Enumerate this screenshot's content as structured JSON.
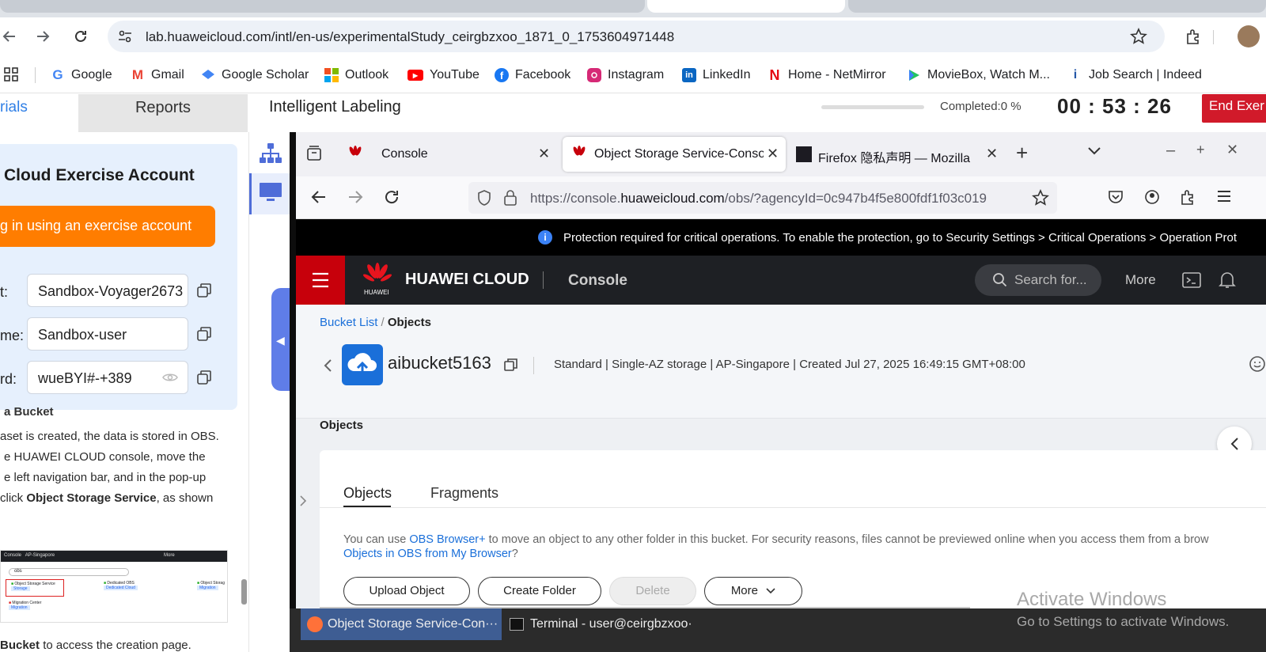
{
  "browser": {
    "url": "lab.huaweicloud.com/intl/en-us/experimentalStudy_ceirgbzxoo_1871_0_1753604971448",
    "bookmarks": [
      {
        "label": "Google",
        "icon": "google-icon",
        "color": "#4285f4"
      },
      {
        "label": "Gmail",
        "icon": "gmail-icon",
        "color": "#ea4335"
      },
      {
        "label": "Google Scholar",
        "icon": "scholar-icon",
        "color": "#4285f4"
      },
      {
        "label": "Outlook",
        "icon": "outlook-icon",
        "color": "#0078d4"
      },
      {
        "label": "YouTube",
        "icon": "youtube-icon",
        "color": "#ff0000"
      },
      {
        "label": "Facebook",
        "icon": "facebook-icon",
        "color": "#1877f2"
      },
      {
        "label": "Instagram",
        "icon": "instagram-icon",
        "color": "#d62976"
      },
      {
        "label": "LinkedIn",
        "icon": "linkedin-icon",
        "color": "#0a66c2"
      },
      {
        "label": "Home - NetMirror",
        "icon": "netmirror-icon",
        "color": "#e50914"
      },
      {
        "label": "MovieBox, Watch M...",
        "icon": "moviebox-icon",
        "color": "#22c55e"
      },
      {
        "label": "Job Search | Indeed",
        "icon": "indeed-icon",
        "color": "#2557a7"
      }
    ]
  },
  "lab": {
    "tab_materials": "rials",
    "tab_reports": "Reports",
    "title": "Intelligent Labeling",
    "completed": "Completed:0 %",
    "timer": "00 : 53 : 26",
    "end_button": "End Exer",
    "account_title": "Cloud Exercise Account",
    "login_button": "g in using an exercise account",
    "account_label": "t:",
    "account_value": "Sandbox-Voyager2673",
    "username_label": "me:",
    "username_value": "Sandbox-user",
    "password_label": "rd:",
    "password_value": "wueBYI#-+389",
    "guide_heading_cut": "a Bucket",
    "guide_lines": [
      "aset is created, the data is stored in OBS.",
      "e HUAWEI CLOUD console, move the",
      "e left navigation bar, and in the pop-up"
    ],
    "guide_line4_pre": "click ",
    "guide_line4_bold": "Object Storage Service",
    "guide_line4_post": ", as shown",
    "guide_tail_bold": "Bucket",
    "guide_tail_rest": " to access the creation page."
  },
  "firefox": {
    "tabs": [
      "Console",
      "Object Storage Service-Conso",
      "Firefox 隐私声明 — Mozilla"
    ],
    "url_pre": "https://console.",
    "url_host": "huaweicloud.com",
    "url_post": "/obs/?agencyId=0c947b4f5e800fdf1f03c019"
  },
  "huawei": {
    "notice": "Protection required for critical operations. To enable the protection, go to Security Settings > Critical Operations > Operation Prot",
    "brand": "HUAWEI CLOUD",
    "logo_sub": "HUAWEI",
    "console_label": "Console",
    "search_placeholder": "Search for...",
    "more_label": "More",
    "breadcrumb_link": "Bucket List",
    "breadcrumb_sep": " / ",
    "breadcrumb_current": "Objects",
    "bucket_name": "aibucket5163",
    "bucket_meta": "Standard | Single-AZ storage | AP-Singapore | Created  Jul 27, 2025 16:49:15 GMT+08:00",
    "section_title": "Objects",
    "tab_objects": "Objects",
    "tab_fragments": "Fragments",
    "info_pre": "You can use ",
    "info_link1": "OBS Browser+",
    "info_mid": " to move an object to any other folder in this bucket. For security reasons, files cannot be previewed online when you access them from a brow",
    "info_link2": "Objects in OBS from My Browser",
    "info_end": "?",
    "btn_upload": "Upload Object",
    "btn_folder": "Create Folder",
    "btn_delete": "Delete",
    "btn_more": "More"
  },
  "taskbar": {
    "item1": "Object Storage Service-Con···",
    "item2": "Terminal - user@ceirgbzxoo···"
  },
  "watermark": {
    "title": "Activate Windows",
    "subtitle": "Go to Settings to activate Windows."
  },
  "mini_screenshot": {
    "console": "Console",
    "region": "AP-Singapore",
    "more": "More",
    "search": "obs",
    "item1": "Object Storage Service",
    "item1_tag": "Storage",
    "item2": "Dedicated OBS",
    "item2_tag": "Dedicated Cloud",
    "item3": "Object Storag",
    "item3_tag": "Migration",
    "item4": "Migration Center",
    "item4_tag": "Migration"
  }
}
